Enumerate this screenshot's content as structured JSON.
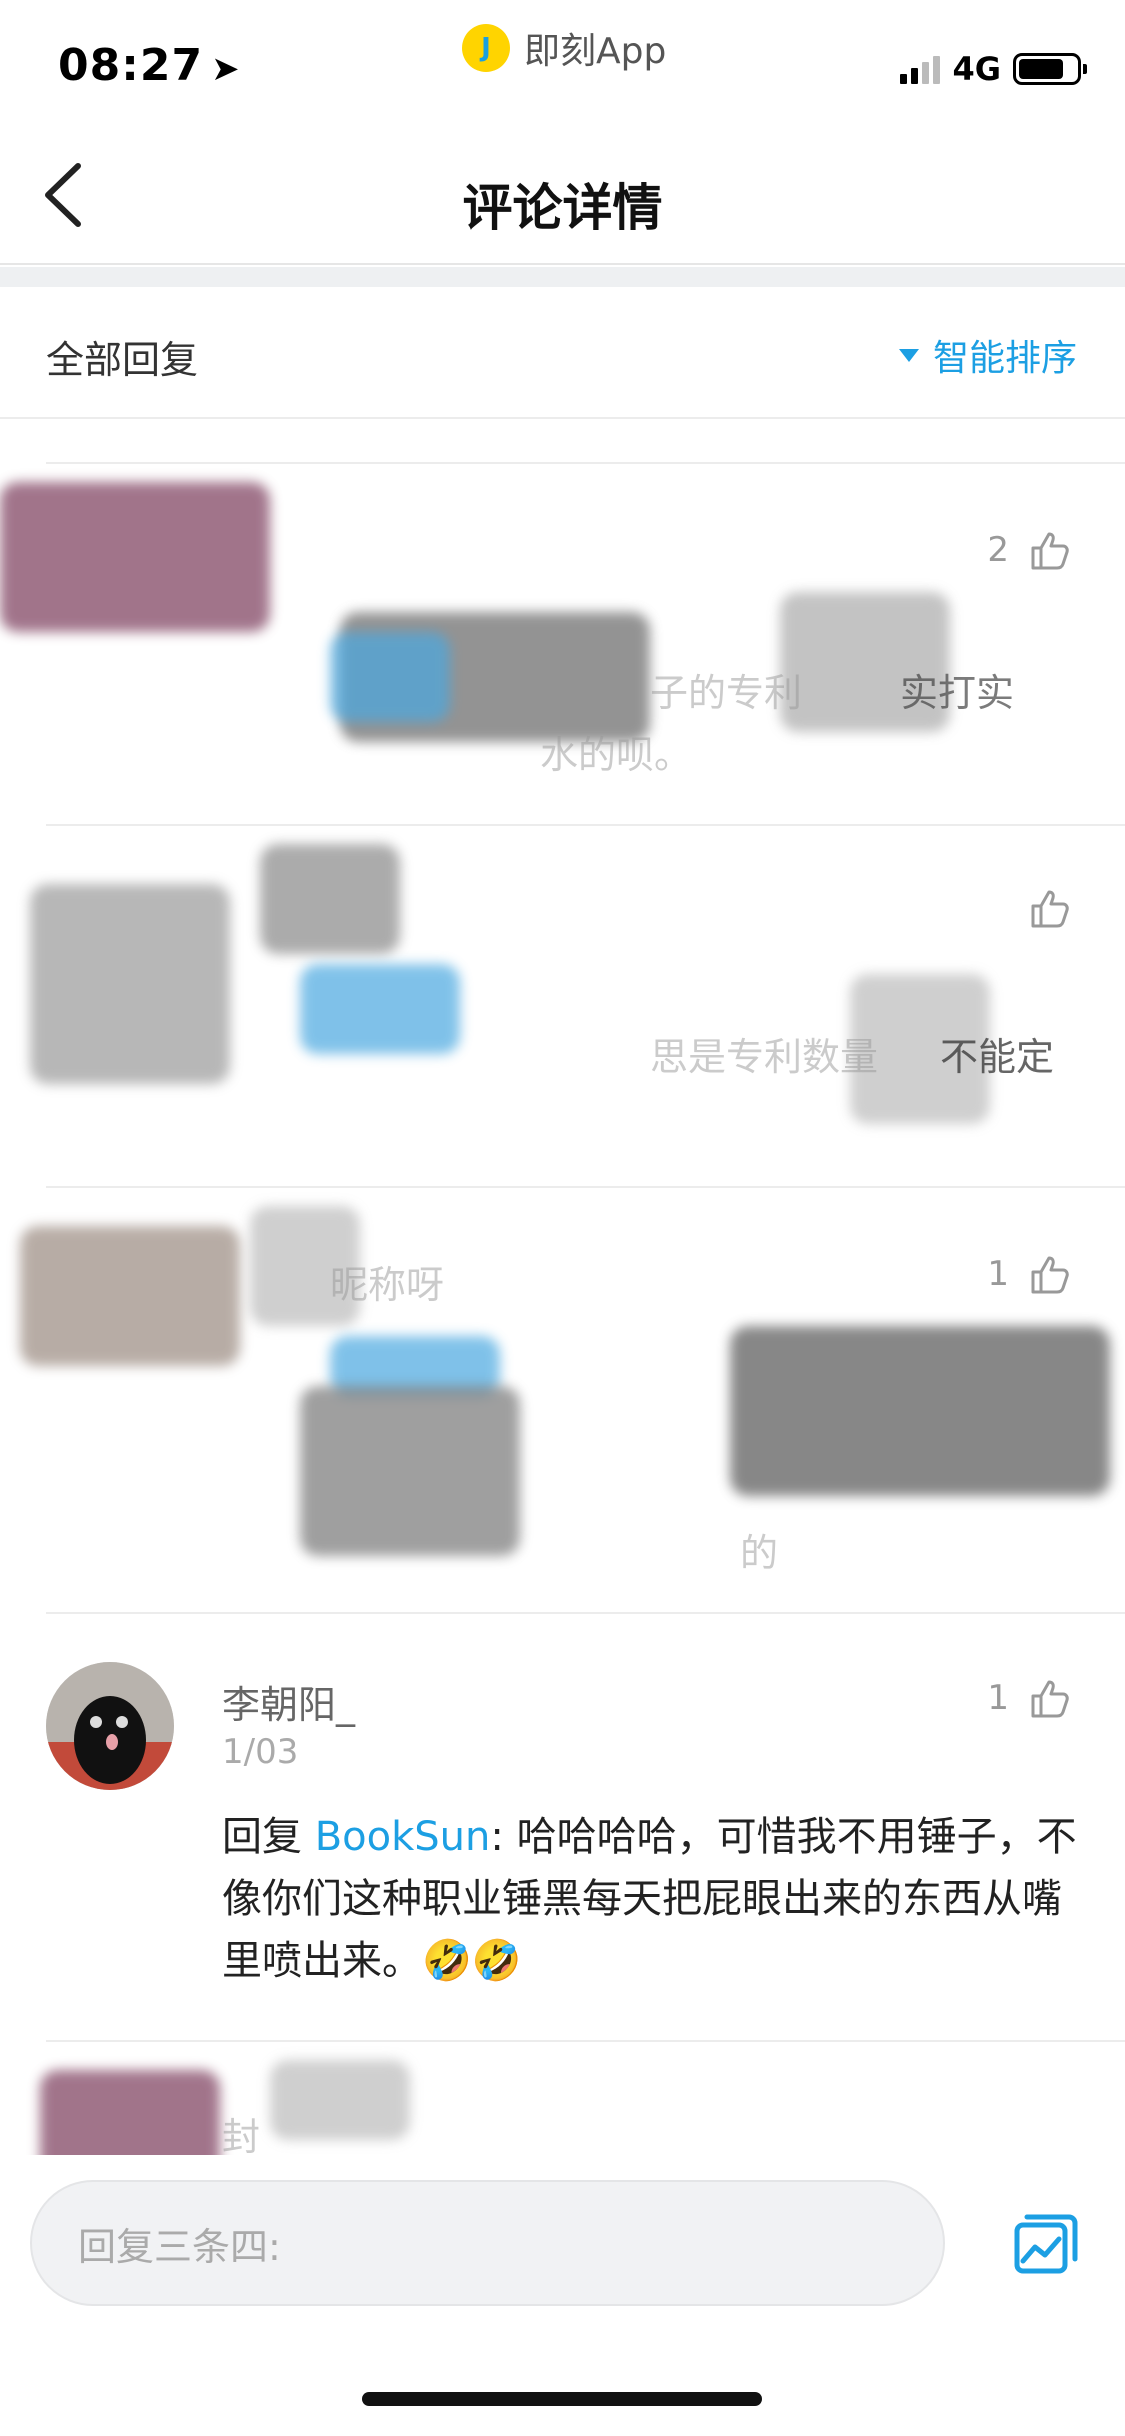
{
  "status": {
    "time": "08:27",
    "app_name": "即刻App",
    "app_logo_letter": "J",
    "network": "4G"
  },
  "nav": {
    "title": "评论详情"
  },
  "header": {
    "all_replies": "全部回复",
    "sort_label": "智能排序"
  },
  "comments": [
    {
      "likes": "2",
      "ghost_text_1": "子的专利",
      "ghost_text_2": "实打实",
      "ghost_text_3": "水的呗。"
    },
    {
      "likes": "",
      "ghost_text_1": "思是专利数量",
      "ghost_text_2": "不能定"
    },
    {
      "likes": "1",
      "ghost_text_1": "昵称呀",
      "ghost_text_2": "的"
    },
    {
      "name": "李朝阳_",
      "date": "1/03",
      "likes": "1",
      "reply_prefix": "回复 ",
      "mention": "BookSun",
      "body": ": 哈哈哈哈，可惜我不用锤子，不像你们这种职业锤黑每天把屁眼出来的东西从嘴里喷出来。",
      "emoji": "🤣🤣"
    },
    {
      "name": "封"
    }
  ],
  "input": {
    "placeholder": "回复三条四:"
  },
  "colors": {
    "accent": "#1c9fe3",
    "logo_yellow": "#ffd400"
  },
  "icons": [
    "back-icon",
    "sort-triangle-icon",
    "like-icon",
    "image-icon",
    "location-arrow-icon"
  ]
}
